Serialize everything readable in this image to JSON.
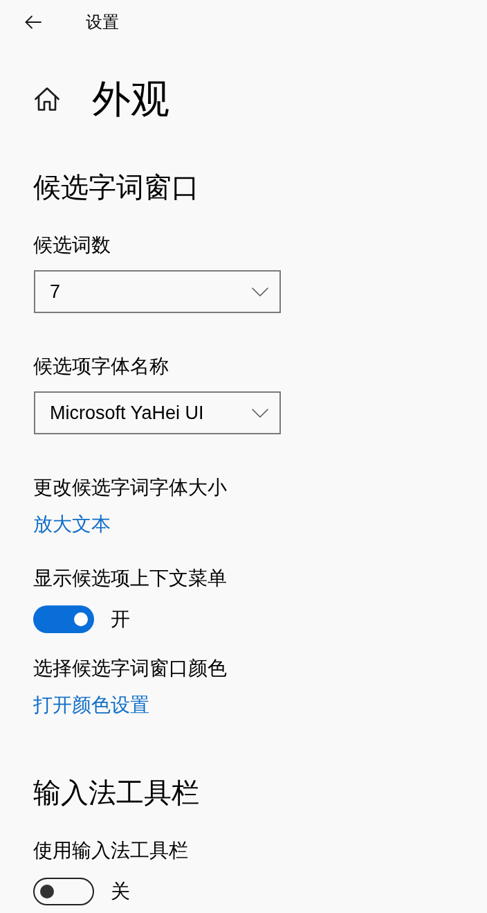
{
  "header": {
    "title": "设置"
  },
  "page": {
    "title": "外观"
  },
  "sections": [
    {
      "heading": "候选字词窗口",
      "items": [
        {
          "kind": "dropdown",
          "label": "候选词数",
          "value": "7"
        },
        {
          "kind": "dropdown",
          "label": "候选项字体名称",
          "value": "Microsoft YaHei UI"
        },
        {
          "kind": "link",
          "label": "更改候选字词字体大小",
          "link": "放大文本"
        },
        {
          "kind": "toggle",
          "label": "显示候选项上下文菜单",
          "on": true,
          "state_label": "开"
        },
        {
          "kind": "link",
          "label": "选择候选字词窗口颜色",
          "link": "打开颜色设置"
        }
      ]
    },
    {
      "heading": "输入法工具栏",
      "items": [
        {
          "kind": "toggle",
          "label": "使用输入法工具栏",
          "on": false,
          "state_label": "关"
        }
      ]
    }
  ]
}
